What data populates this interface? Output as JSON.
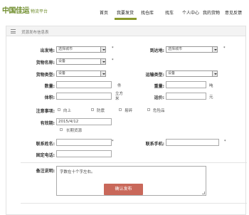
{
  "brand": {
    "main": "中国佳运",
    "sub": "物流平台"
  },
  "nav": [
    {
      "label": "首页"
    },
    {
      "label": "我要发货"
    },
    {
      "label": "找仓库"
    },
    {
      "label": "找车"
    },
    {
      "label": "个人中心"
    },
    {
      "label": "我的货物"
    },
    {
      "label": "意见反馈"
    }
  ],
  "panel": {
    "title": "货源发布信息表"
  },
  "form": {
    "origin": {
      "label": "出发地:",
      "value": "选择城市"
    },
    "destination": {
      "label": "到达地:",
      "value": "选择城市"
    },
    "cargo_name": {
      "label": "货物名称:",
      "value": "设备"
    },
    "cargo_type": {
      "label": "货物类型:",
      "value": "设备"
    },
    "transport_type": {
      "label": "运输类型:",
      "value": "设备"
    },
    "quantity": {
      "label": "数量:",
      "unit": "件"
    },
    "weight": {
      "label": "重量:",
      "unit": "吨"
    },
    "volume": {
      "label": "体积:",
      "unit": "立方米"
    },
    "freight": {
      "label": "运价:",
      "unit": "元"
    },
    "notes": {
      "label": "注意事项:",
      "options": [
        "向上",
        "防震",
        "易碎",
        "危险品"
      ]
    },
    "validity": {
      "label": "有效期:",
      "value": "2015/4/12",
      "long_term": "长期货源"
    },
    "contact_name": {
      "label": "联系姓名:"
    },
    "contact_mobile": {
      "label": "联系手机:"
    },
    "landline": {
      "label": "固定电话:"
    },
    "remarks": {
      "label": "备注说明:",
      "placeholder": "字数在十个字左右。"
    },
    "required_mark": "*"
  },
  "submit": {
    "label": "确认发布"
  },
  "colors": {
    "brand": "#6f8d2c",
    "nav_active": "#8a9a2e",
    "submit": "#c9685a"
  }
}
